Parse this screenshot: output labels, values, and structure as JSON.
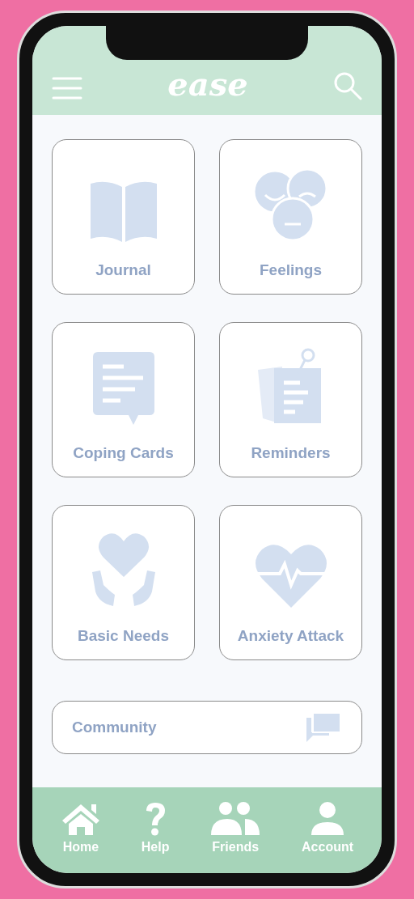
{
  "app": {
    "logo": "ease"
  },
  "tiles": [
    {
      "label": "Journal",
      "kind": "book"
    },
    {
      "label": "Feelings",
      "kind": "faces"
    },
    {
      "label": "Coping Cards",
      "kind": "chat"
    },
    {
      "label": "Reminders",
      "kind": "note"
    },
    {
      "label": "Basic Needs",
      "kind": "hands"
    },
    {
      "label": "Anxiety Attack",
      "kind": "heartbeat"
    }
  ],
  "community": {
    "label": "Community"
  },
  "nav": [
    {
      "label": "Home",
      "kind": "home"
    },
    {
      "label": "Help",
      "kind": "help"
    },
    {
      "label": "Friends",
      "kind": "friends"
    },
    {
      "label": "Account",
      "kind": "account"
    }
  ]
}
